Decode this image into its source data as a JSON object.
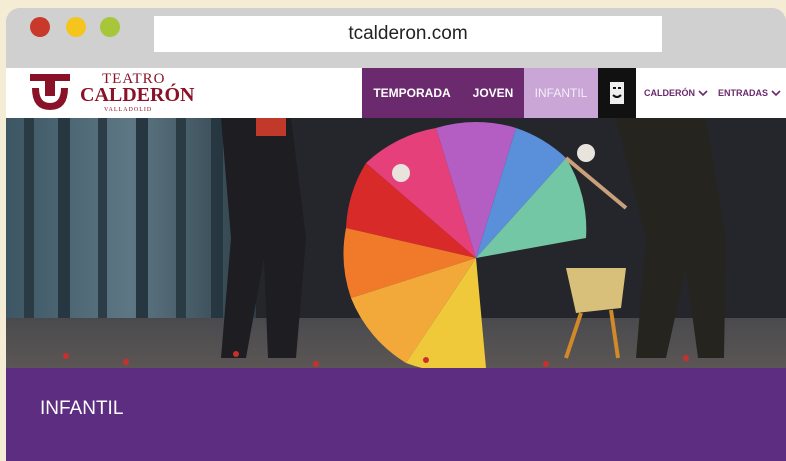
{
  "window": {
    "url": "tcalderon.com",
    "traffic_lights": [
      "close",
      "minimize",
      "maximize"
    ],
    "colors": {
      "close": "#c8382b",
      "minimize": "#f4c51d",
      "maximize": "#a7c63a"
    }
  },
  "logo": {
    "line1": "TEATRO",
    "line2": "CALDERÓN",
    "line3": "VALLADOLID",
    "icon": "teatro-calderon-logo-icon",
    "color": "#8a1228"
  },
  "nav": {
    "tabs": [
      {
        "label": "TEMPORADA",
        "active": false
      },
      {
        "label": "JOVEN",
        "active": false
      },
      {
        "label": "INFANTIL",
        "active": true
      }
    ],
    "dark_icon": "mask-icon",
    "menus": [
      {
        "label": "CALDERÓN",
        "icon": "chevron-down-icon"
      },
      {
        "label": "ENTRADAS",
        "icon": "chevron-down-icon"
      }
    ],
    "colors": {
      "tab": "#6b2a6e",
      "active_tab": "#c9a6d6"
    }
  },
  "hero": {
    "description_icon": "hero-image",
    "alt": ""
  },
  "section": {
    "title": "INFANTIL",
    "color": "#5c2d80"
  }
}
